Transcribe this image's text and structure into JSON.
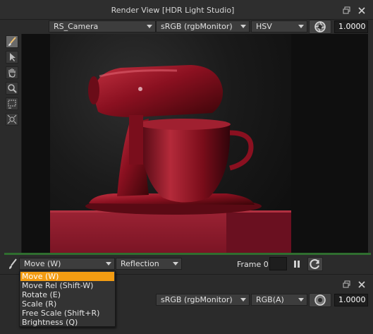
{
  "window": {
    "title": "Render View [HDR Light Studio]"
  },
  "toolbar": {
    "camera": "RS_Camera",
    "color_space": "sRGB (rgbMonitor)",
    "channel_mode": "HSV",
    "exposure": "1.0000"
  },
  "side_tools": [
    {
      "name": "paint-brush-icon",
      "active": true
    },
    {
      "name": "select-arrow-icon"
    },
    {
      "name": "pan-hand-icon"
    },
    {
      "name": "zoom-magnifier-icon"
    },
    {
      "name": "region-select-icon"
    },
    {
      "name": "fit-view-icon"
    }
  ],
  "bottom_bar": {
    "tool_mode": "Move (W)",
    "light_effect": "Reflection",
    "frame_label": "Frame 0"
  },
  "lower_window": {
    "color_space": "sRGB (rgbMonitor)",
    "channel_mode": "RGB(A)",
    "exposure": "1.0000"
  },
  "mode_menu": {
    "items": [
      "Move (W)",
      "Move Rel (Shift-W)",
      "Rotate (E)",
      "Scale (R)",
      "Free Scale (Shift+R)",
      "Brightness (Q)"
    ],
    "selected_index": 0
  },
  "colors": {
    "accent_highlight": "#f39c12",
    "progress_line": "#2f6e2f",
    "mixer_red": "#8a1020",
    "pedestal_red": "#8f1a2a"
  }
}
